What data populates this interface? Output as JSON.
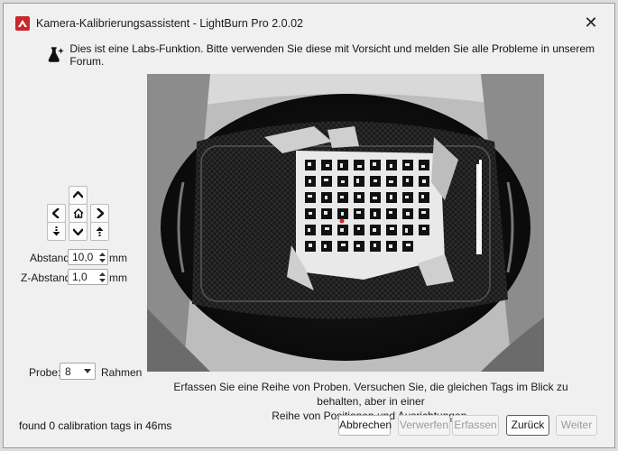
{
  "window": {
    "title": "Kamera-Kalibrierungsassistent - LightBurn Pro 2.0.02",
    "close_glyph": "✕"
  },
  "banner": {
    "icon": "flask-sparkle-icon",
    "text": "Dies ist eine Labs-Funktion. Bitte verwenden Sie diese mit Vorsicht und melden Sie alle Probleme in unserem Forum."
  },
  "controls": {
    "abstand_label": "Abstand",
    "abstand_value": "10,0",
    "abstand_unit": "mm",
    "z_abstand_label": "Z-Abstand",
    "z_abstand_value": "1,0",
    "z_abstand_unit": "mm",
    "probe_label": "Probe:",
    "probe_value": "8",
    "rahmen_label": "Rahmen"
  },
  "instructions": {
    "line1": "Erfassen Sie eine Reihe von Proben. Versuchen Sie, die gleichen Tags im Blick zu behalten, aber in einer",
    "line2": "Reihe von Positionen und Ausrichtungen."
  },
  "status": {
    "text": "found 0 calibration tags in 46ms"
  },
  "buttons": {
    "abbrechen": "Abbrechen",
    "verwerfen": "Verwerfen",
    "erfassen": "Erfassen",
    "zurueck": "Zurück",
    "weiter": "Weiter"
  },
  "colors": {
    "accent_red": "#c8282c",
    "disabled_text": "#9a9a9a"
  }
}
